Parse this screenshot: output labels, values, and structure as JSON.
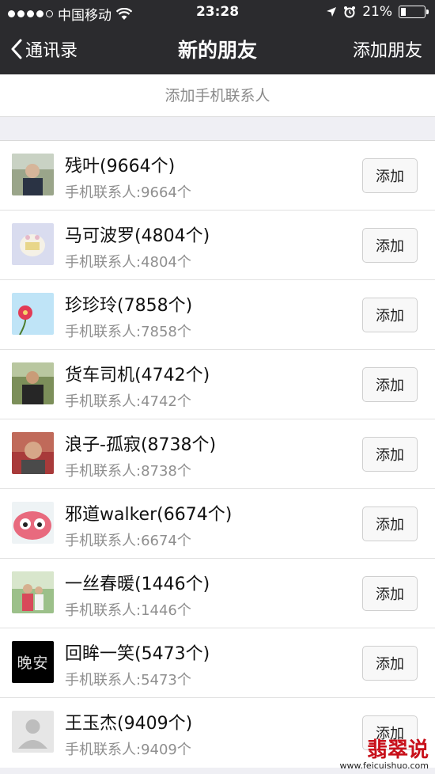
{
  "status_bar": {
    "carrier": "中国移动",
    "time": "23:28",
    "battery": "21%",
    "battery_level": 0.21
  },
  "nav": {
    "back_label": "通讯录",
    "title": "新的朋友",
    "add_friends_label": "添加朋友"
  },
  "add_phone_contacts": "添加手机联系人",
  "contacts": [
    {
      "name": "残叶(9664个)",
      "sub": "手机联系人:9664个",
      "button": "添加"
    },
    {
      "name": "马可波罗(4804个)",
      "sub": "手机联系人:4804个",
      "button": "添加"
    },
    {
      "name": "珍珍玲(7858个)",
      "sub": "手机联系人:7858个",
      "button": "添加"
    },
    {
      "name": "货车司机(4742个)",
      "sub": "手机联系人:4742个",
      "button": "添加"
    },
    {
      "name": "浪子-孤寂(8738个)",
      "sub": "手机联系人:8738个",
      "button": "添加"
    },
    {
      "name": "邪道walker(6674个)",
      "sub": "手机联系人:6674个",
      "button": "添加"
    },
    {
      "name": "一丝春暖(1446个)",
      "sub": "手机联系人:1446个",
      "button": "添加"
    },
    {
      "name": "回眸一笑(5473个)",
      "sub": "手机联系人:5473个",
      "button": "添加"
    },
    {
      "name": "王玉杰(9409个)",
      "sub": "手机联系人:9409个",
      "button": "添加"
    }
  ],
  "avatar_8_text": "晚安",
  "watermark": {
    "text": "翡翠说",
    "url": "www.feicuishuo.com"
  }
}
